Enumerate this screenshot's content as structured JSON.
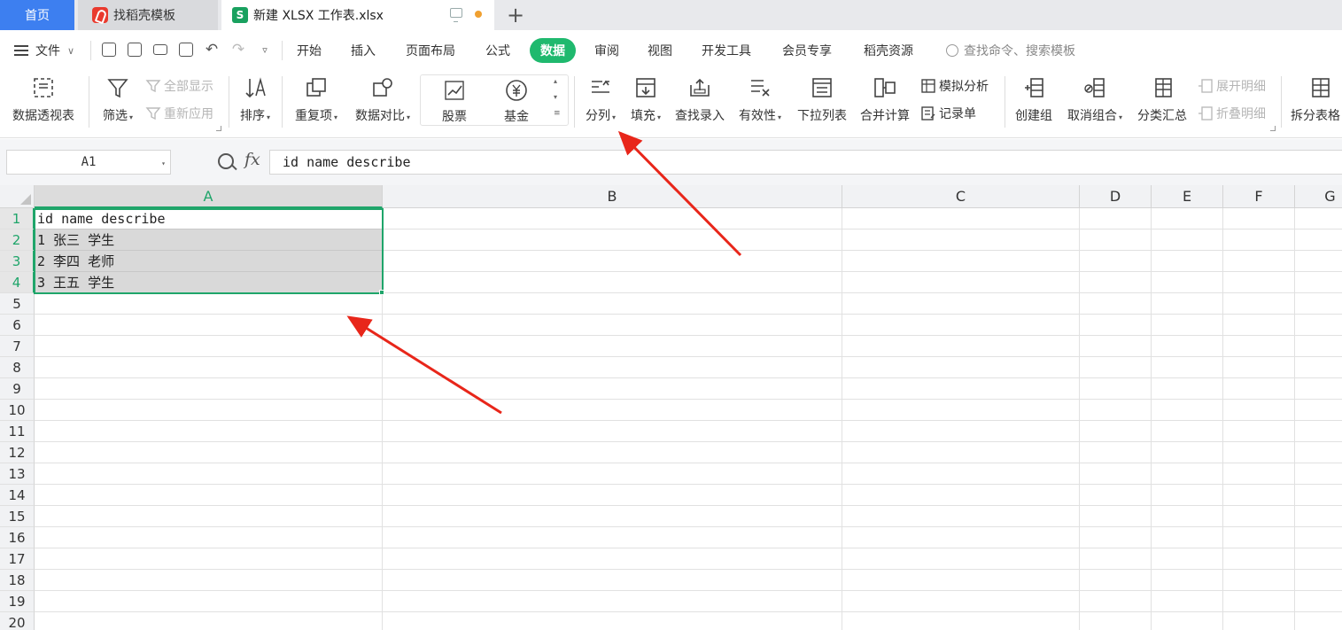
{
  "tabs": {
    "home": "首页",
    "template": "找稻壳模板",
    "file": "新建 XLSX 工作表.xlsx",
    "file_icon_letter": "S"
  },
  "menu": {
    "file": "文件",
    "items": [
      "开始",
      "插入",
      "页面布局",
      "公式",
      "数据",
      "审阅",
      "视图",
      "开发工具",
      "会员专享",
      "稻壳资源"
    ],
    "active": "数据",
    "search_placeholder": "查找命令、搜索模板"
  },
  "ribbon": {
    "pivot": "数据透视表",
    "filter": "筛选",
    "show_all": "全部显示",
    "reapply": "重新应用",
    "sort": "排序",
    "duplicates": "重复项",
    "compare": "数据对比",
    "stocks": "股票",
    "funds": "基金",
    "split_column": "分列",
    "fill": "填充",
    "lookup_entry": "查找录入",
    "validity": "有效性",
    "dropdown_list": "下拉列表",
    "consolidate": "合并计算",
    "what_if": "模拟分析",
    "record_form": "记录单",
    "create_group": "创建组",
    "ungroup": "取消组合",
    "subtotal": "分类汇总",
    "expand_detail": "展开明细",
    "collapse_detail": "折叠明细",
    "split_table": "拆分表格"
  },
  "formula_bar": {
    "name_box": "A1",
    "fx": "fx",
    "content": "id name describe"
  },
  "sheet": {
    "columns": [
      "A",
      "B",
      "C",
      "D",
      "E",
      "F",
      "G"
    ],
    "rows": [
      "1",
      "2",
      "3",
      "4",
      "5",
      "6",
      "7",
      "8",
      "9",
      "10",
      "11",
      "12",
      "13",
      "14",
      "15",
      "16",
      "17",
      "18",
      "19",
      "20"
    ],
    "cells": [
      "id name describe",
      "1 张三 学生",
      "2 李四 老师",
      "3 王五 学生"
    ],
    "selected_range": "A1:A4"
  },
  "colors": {
    "accent_green": "#1fb96e",
    "home_tab_blue": "#3d7ff0",
    "annotation_red": "#e8261a"
  }
}
